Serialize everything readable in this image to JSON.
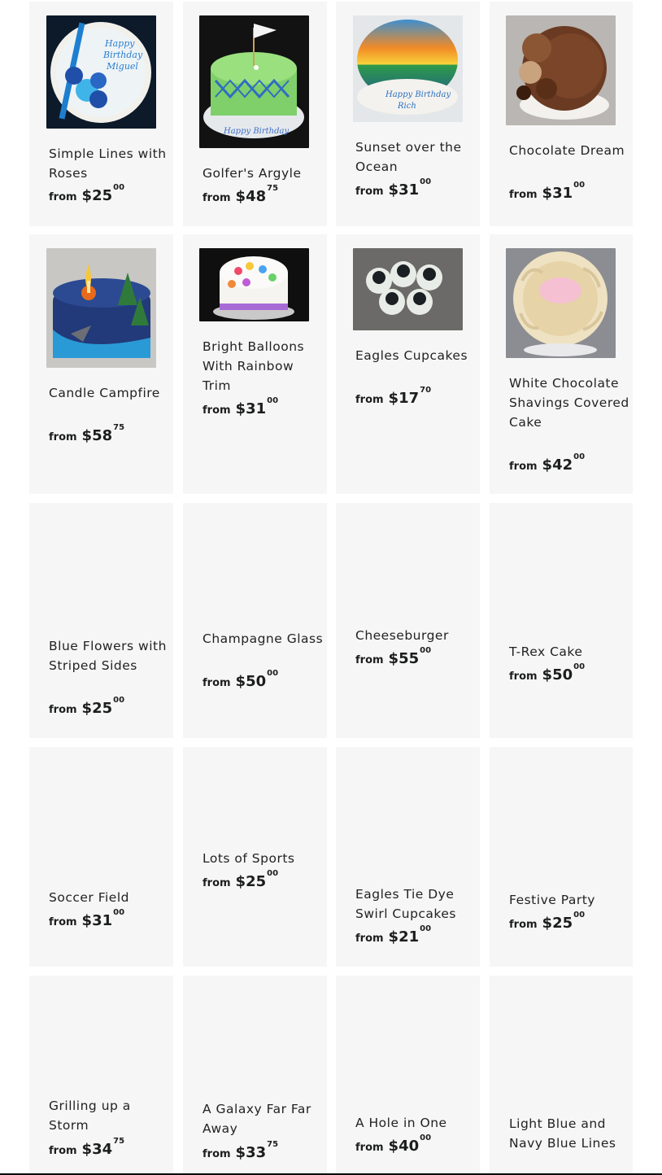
{
  "products": [
    {
      "title": "Simple Lines with Roses",
      "from": "from",
      "dollars": "$25",
      "cents": "00",
      "image": "cake-blue-roses"
    },
    {
      "title": "Golfer's Argyle",
      "from": "from",
      "dollars": "$48",
      "cents": "75",
      "image": "cake-golf-argyle"
    },
    {
      "title": "Sunset over the Ocean",
      "from": "from",
      "dollars": "$31",
      "cents": "00",
      "image": "cake-sunset"
    },
    {
      "title": "Chocolate Dream",
      "from": "from",
      "dollars": "$31",
      "cents": "00",
      "image": "cake-chocolate"
    },
    {
      "title": "Candle Campfire",
      "from": "from",
      "dollars": "$58",
      "cents": "75",
      "image": "cake-campfire"
    },
    {
      "title": "Bright Balloons With Rainbow Trim",
      "from": "from",
      "dollars": "$31",
      "cents": "00",
      "image": "cake-balloons"
    },
    {
      "title": "Eagles Cupcakes",
      "from": "from",
      "dollars": "$17",
      "cents": "70",
      "image": "cupcakes-eagles"
    },
    {
      "title": "White Chocolate Shavings Covered Cake",
      "from": "from",
      "dollars": "$42",
      "cents": "00",
      "image": "cake-white-shavings"
    },
    {
      "title": "Blue Flowers with Striped Sides",
      "from": "from",
      "dollars": "$25",
      "cents": "00",
      "image": ""
    },
    {
      "title": "Champagne Glass",
      "from": "from",
      "dollars": "$50",
      "cents": "00",
      "image": ""
    },
    {
      "title": "Cheeseburger",
      "from": "from",
      "dollars": "$55",
      "cents": "00",
      "image": ""
    },
    {
      "title": "T-Rex Cake",
      "from": "from",
      "dollars": "$50",
      "cents": "00",
      "image": ""
    },
    {
      "title": "Soccer Field",
      "from": "from",
      "dollars": "$31",
      "cents": "00",
      "image": ""
    },
    {
      "title": "Lots of Sports",
      "from": "from",
      "dollars": "$25",
      "cents": "00",
      "image": ""
    },
    {
      "title": "Eagles Tie Dye Swirl Cupcakes",
      "from": "from",
      "dollars": "$21",
      "cents": "00",
      "image": ""
    },
    {
      "title": "Festive Party",
      "from": "from",
      "dollars": "$25",
      "cents": "00",
      "image": ""
    },
    {
      "title": "Grilling up a Storm",
      "from": "from",
      "dollars": "$34",
      "cents": "75",
      "image": ""
    },
    {
      "title": "A Galaxy Far Far Away",
      "from": "from",
      "dollars": "$33",
      "cents": "75",
      "image": ""
    },
    {
      "title": "A Hole in One",
      "from": "from",
      "dollars": "$40",
      "cents": "00",
      "image": ""
    },
    {
      "title": "Light Blue and Navy Blue Lines",
      "from": "from",
      "dollars": "",
      "cents": "",
      "image": ""
    }
  ]
}
